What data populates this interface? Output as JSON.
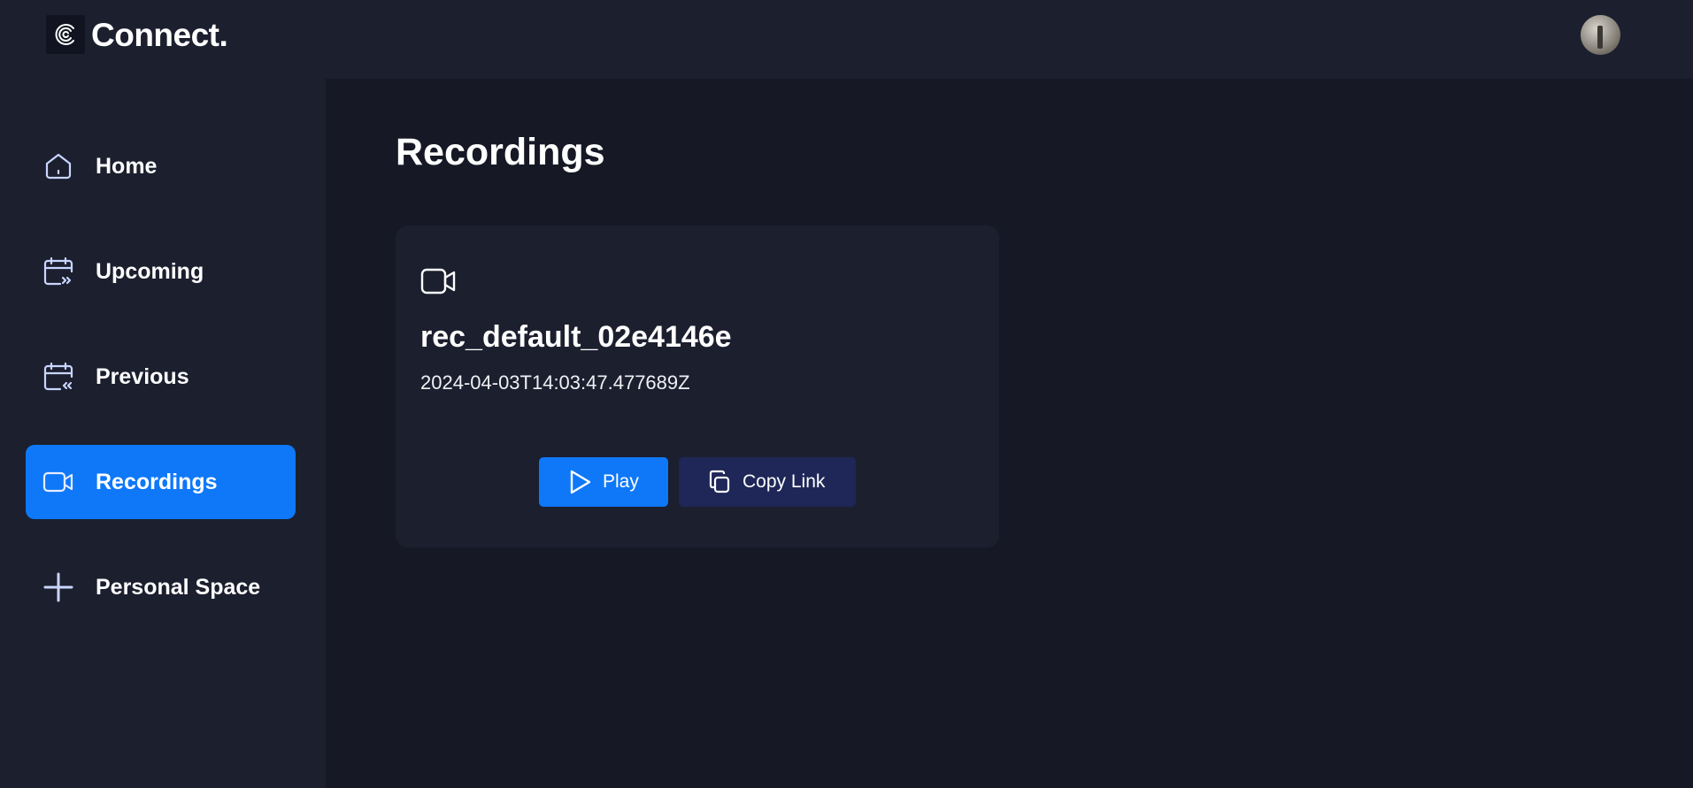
{
  "app": {
    "brand": "Connect.",
    "logo_icon": "c-logo-icon",
    "avatar": "user-avatar"
  },
  "sidebar": {
    "items": [
      {
        "label": "Home",
        "icon": "home-icon",
        "active": false
      },
      {
        "label": "Upcoming",
        "icon": "calendar-upcoming-icon",
        "active": false
      },
      {
        "label": "Previous",
        "icon": "calendar-previous-icon",
        "active": false
      },
      {
        "label": "Recordings",
        "icon": "video-icon",
        "active": true
      },
      {
        "label": "Personal Space",
        "icon": "plus-icon",
        "active": false
      }
    ]
  },
  "main": {
    "title": "Recordings",
    "recordings": [
      {
        "icon": "video-icon",
        "name": "rec_default_02e4146e",
        "timestamp": "2024-04-03T14:03:47.477689Z",
        "play_label": "Play",
        "copy_label": "Copy Link"
      }
    ]
  },
  "colors": {
    "background": "#161925",
    "panel": "#1c1f2e",
    "accent": "#0e78f9",
    "secondary_button": "#1e2757"
  }
}
